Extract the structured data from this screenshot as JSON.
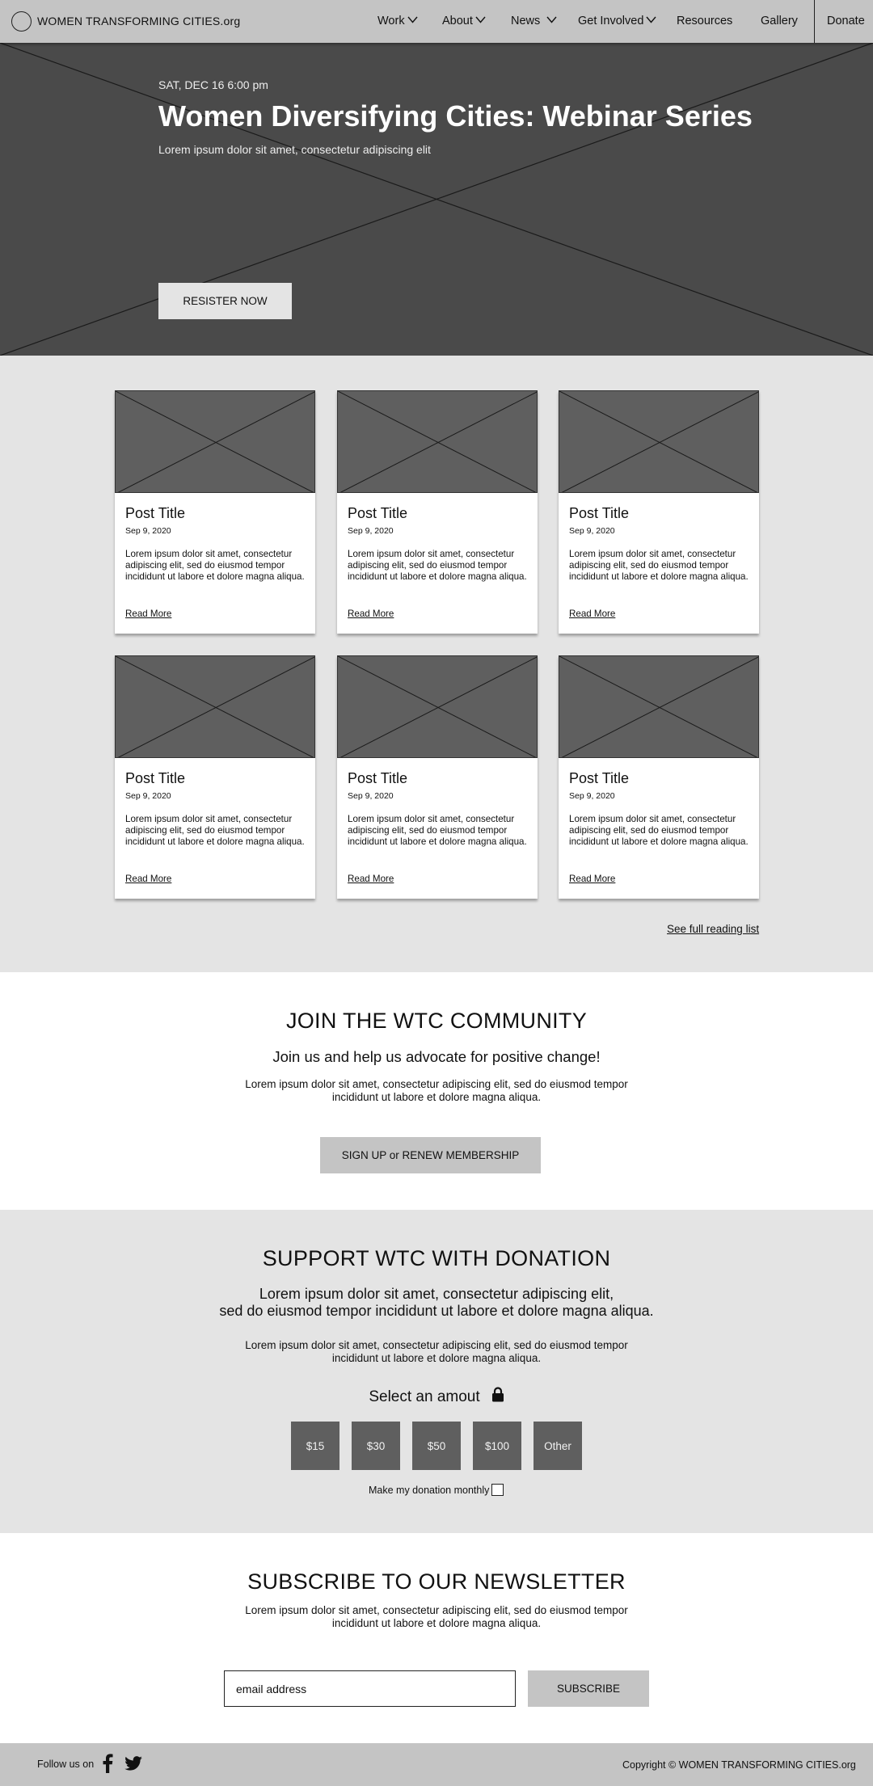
{
  "header": {
    "logo_text": "WOMEN TRANSFORMING CITIES.org",
    "nav": [
      {
        "label": "Work",
        "dropdown": true
      },
      {
        "label": "About",
        "dropdown": true
      },
      {
        "label": "News",
        "dropdown": true
      },
      {
        "label": "Get Involved",
        "dropdown": true
      },
      {
        "label": "Resources",
        "dropdown": false
      },
      {
        "label": "Gallery",
        "dropdown": false
      }
    ],
    "donate_label": "Donate"
  },
  "hero": {
    "date": "SAT, DEC 16 6:00 pm",
    "title": "Women Diversifying Cities: Webinar Series",
    "subtitle": "Lorem ipsum dolor sit amet, consectetur adipiscing elit",
    "button_label": "RESISTER NOW"
  },
  "posts": {
    "items": [
      {
        "title": "Post Title",
        "date": "Sep 9, 2020",
        "excerpt": "Lorem ipsum dolor sit amet, consectetur adipiscing elit, sed do eiusmod tempor incididunt ut labore et dolore magna aliqua.",
        "link": "Read More"
      },
      {
        "title": "Post Title",
        "date": "Sep 9, 2020",
        "excerpt": "Lorem ipsum dolor sit amet, consectetur adipiscing elit, sed do eiusmod tempor incididunt ut labore et dolore magna aliqua.",
        "link": "Read More"
      },
      {
        "title": "Post Title",
        "date": "Sep 9, 2020",
        "excerpt": "Lorem ipsum dolor sit amet, consectetur adipiscing elit, sed do eiusmod tempor incididunt ut labore et dolore magna aliqua.",
        "link": "Read More"
      },
      {
        "title": "Post Title",
        "date": "Sep 9, 2020",
        "excerpt": "Lorem ipsum dolor sit amet, consectetur adipiscing elit, sed do eiusmod tempor incididunt ut labore et dolore magna aliqua.",
        "link": "Read More"
      },
      {
        "title": "Post Title",
        "date": "Sep 9, 2020",
        "excerpt": "Lorem ipsum dolor sit amet, consectetur adipiscing elit, sed do eiusmod tempor incididunt ut labore et dolore magna aliqua.",
        "link": "Read More"
      },
      {
        "title": "Post Title",
        "date": "Sep 9, 2020",
        "excerpt": "Lorem ipsum dolor sit amet, consectetur adipiscing elit, sed do eiusmod tempor incididunt ut labore et dolore magna aliqua.",
        "link": "Read More"
      }
    ],
    "full_list_link": "See full reading list"
  },
  "join": {
    "title": "JOIN THE WTC COMMUNITY",
    "subtitle": "Join us and help us advocate for positive change!",
    "text": "Lorem ipsum dolor sit amet, consectetur adipiscing elit, sed do eiusmod tempor incididunt ut labore et dolore magna aliqua.",
    "button_label": "SIGN UP or RENEW MEMBERSHIP"
  },
  "donation": {
    "title": "SUPPORT WTC WITH DONATION",
    "subtitle_line1": "Lorem ipsum dolor sit amet, consectetur adipiscing elit,",
    "subtitle_line2": "sed do eiusmod tempor incididunt ut labore et dolore magna aliqua.",
    "text": "Lorem ipsum dolor sit amet, consectetur adipiscing elit, sed do eiusmod tempor incididunt ut labore et dolore magna aliqua.",
    "select_label": "Select an amout",
    "amounts": [
      "$15",
      "$30",
      "$50",
      "$100",
      "Other"
    ],
    "monthly_label": "Make my donation monthly",
    "monthly_checked": false
  },
  "newsletter": {
    "title": "SUBSCRIBE TO OUR NEWSLETTER",
    "text": "Lorem ipsum dolor sit amet, consectetur adipiscing elit, sed do eiusmod tempor incididunt ut labore et dolore magna aliqua.",
    "email_placeholder": "email address",
    "button_label": "SUBSCRIBE"
  },
  "footer": {
    "follow_label": "Follow us on",
    "social_icons": [
      "facebook-icon",
      "twitter-icon"
    ],
    "copyright": "Copyright © WOMEN TRANSFORMING CITIES.org"
  },
  "colors": {
    "nav_bg": "#c4c4c4",
    "hero_bg": "#4a4a4a",
    "section_gray": "#e4e4e4",
    "placeholder_image": "#5f5f5f",
    "amount_button": "#5f5f5f"
  }
}
